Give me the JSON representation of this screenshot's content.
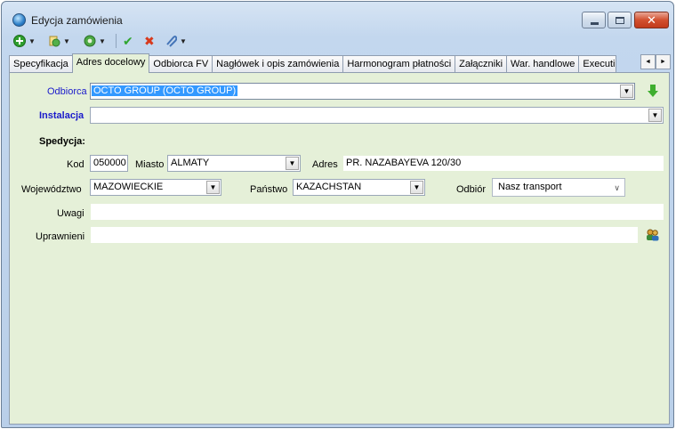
{
  "window": {
    "title": "Edycja zamówienia",
    "close_glyph": "✕"
  },
  "toolbar": {
    "icons": [
      "add-icon",
      "refresh-icon",
      "settings-icon",
      "confirm-check-icon",
      "cancel-x-icon",
      "attach-icon"
    ],
    "dropdown_glyph": "▼",
    "check_glyph": "✔",
    "cross_glyph": "✖"
  },
  "tabs": [
    {
      "label": "Specyfikacja"
    },
    {
      "label": "Adres docelowy",
      "active": true
    },
    {
      "label": "Odbiorca FV"
    },
    {
      "label": "Nagłówek i opis zamówienia"
    },
    {
      "label": "Harmonogram płatności"
    },
    {
      "label": "Załączniki"
    },
    {
      "label": "War. handlowe"
    },
    {
      "label": "Executi"
    }
  ],
  "tab_scroll": {
    "left": "◄",
    "right": "►"
  },
  "form": {
    "odbiorca_label": "Odbiorca",
    "odbiorca_value": "OCTO GROUP (OCTO GROUP)",
    "instalacja_label": "Instalacja",
    "instalacja_value": "",
    "spedycja_label": "Spedycja:",
    "kod_label": "Kod",
    "kod_value": "050000",
    "miasto_label": "Miasto",
    "miasto_value": "ALMATY",
    "adres_label": "Adres",
    "adres_value": "PR. NAZABAYEVA 120/30",
    "wojewodztwo_label": "Województwo",
    "wojewodztwo_value": "MAZOWIECKIE",
    "panstwo_label": "Państwo",
    "panstwo_value": "KAZACHSTAN",
    "odbior_label": "Odbiór",
    "odbior_value": "Nasz transport",
    "uwagi_label": "Uwagi",
    "uwagi_value": "",
    "uprawnieni_label": "Uprawnieni",
    "uprawnieni_value": "",
    "combo_arrow": "▼",
    "modern_arrow": "∨"
  },
  "colors": {
    "panel_bg": "#e5f0d8",
    "selection": "#3399ff",
    "label_blue": "#1a1acb"
  }
}
